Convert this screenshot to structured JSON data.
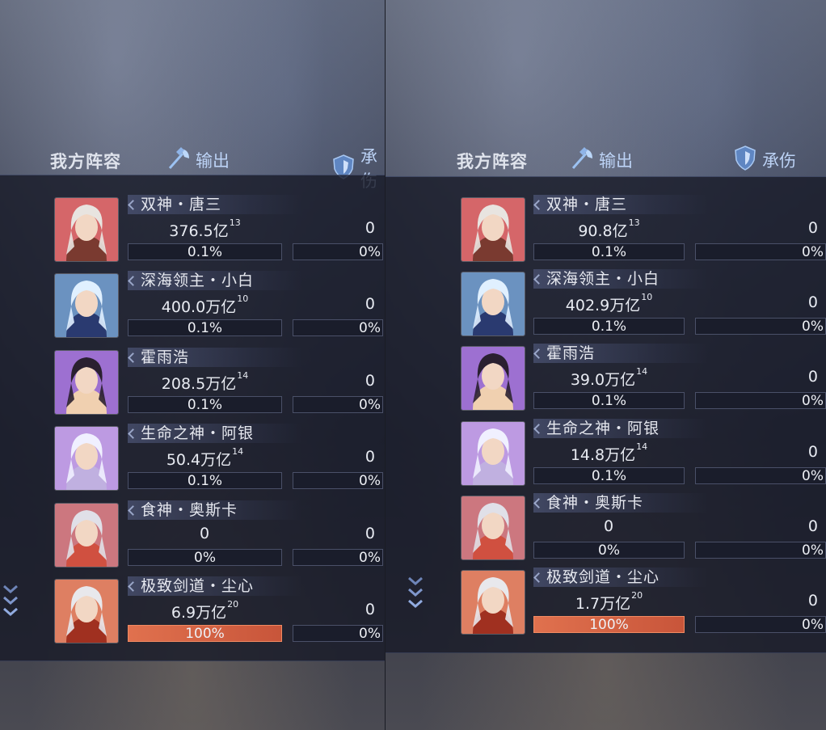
{
  "header": {
    "title": "我方阵容",
    "tab_output": "输出",
    "tab_taken_left": "承伤",
    "tab_taken_right": "承伤"
  },
  "left": {
    "rows": [
      {
        "name": "双神・唐三",
        "value": "376.5亿",
        "sup": "13",
        "pct": "0.1%",
        "taken": "0",
        "taken_pct": "0%"
      },
      {
        "name": "深海领主・小白",
        "value": "400.0万亿",
        "sup": "10",
        "pct": "0.1%",
        "taken": "0",
        "taken_pct": "0%"
      },
      {
        "name": "霍雨浩",
        "value": "208.5万亿",
        "sup": "14",
        "pct": "0.1%",
        "taken": "0",
        "taken_pct": "0%"
      },
      {
        "name": "生命之神・阿银",
        "value": "50.4万亿",
        "sup": "14",
        "pct": "0.1%",
        "taken": "0",
        "taken_pct": "0%"
      },
      {
        "name": "食神・奥斯卡",
        "value": "0",
        "sup": "",
        "pct": "0%",
        "taken": "0",
        "taken_pct": "0%"
      },
      {
        "name": "极致剑道・尘心",
        "value": "6.9万亿",
        "sup": "20",
        "pct": "100%",
        "taken": "0",
        "taken_pct": "0%"
      }
    ]
  },
  "right": {
    "rows": [
      {
        "name": "双神・唐三",
        "value": "90.8亿",
        "sup": "13",
        "pct": "0.1%",
        "taken": "0",
        "taken_pct": "0%"
      },
      {
        "name": "深海领主・小白",
        "value": "402.9万亿",
        "sup": "10",
        "pct": "0.1%",
        "taken": "0",
        "taken_pct": "0%"
      },
      {
        "name": "霍雨浩",
        "value": "39.0万亿",
        "sup": "14",
        "pct": "0.1%",
        "taken": "0",
        "taken_pct": "0%"
      },
      {
        "name": "生命之神・阿银",
        "value": "14.8万亿",
        "sup": "14",
        "pct": "0.1%",
        "taken": "0",
        "taken_pct": "0%"
      },
      {
        "name": "食神・奥斯卡",
        "value": "0",
        "sup": "",
        "pct": "0%",
        "taken": "0",
        "taken_pct": "0%"
      },
      {
        "name": "极致剑道・尘心",
        "value": "1.7万亿",
        "sup": "20",
        "pct": "100%",
        "taken": "0",
        "taken_pct": "0%"
      }
    ]
  },
  "colors": {
    "full_bar": "#e0714e",
    "panel_bg": "#181b28",
    "accent": "#bcd2f5"
  },
  "icons": {
    "output": "axe-icon",
    "taken": "shield-icon",
    "scroll": "chevron-down-icon"
  }
}
